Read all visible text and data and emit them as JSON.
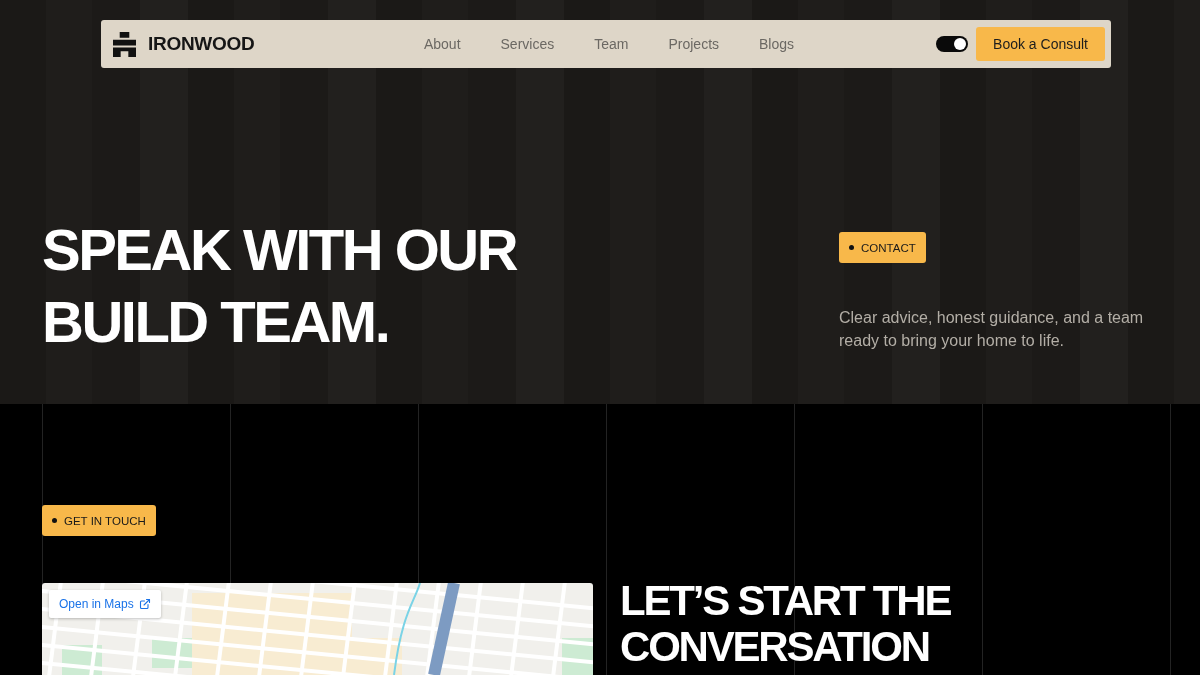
{
  "nav": {
    "brand": "IRONWOOD",
    "links": [
      "About",
      "Services",
      "Team",
      "Projects",
      "Blogs"
    ],
    "toggle": {
      "on": true
    },
    "cta": "Book a Consult"
  },
  "hero": {
    "title": "SPEAK WITH OUR BUILD TEAM.",
    "badge": "CONTACT",
    "description": "Clear advice, honest guidance, and a team ready to bring your home to life."
  },
  "contact": {
    "badge": "GET IN TOUCH",
    "map": {
      "open_button": "Open in Maps"
    },
    "title": "LET’S START THE CONVERSATION"
  }
}
